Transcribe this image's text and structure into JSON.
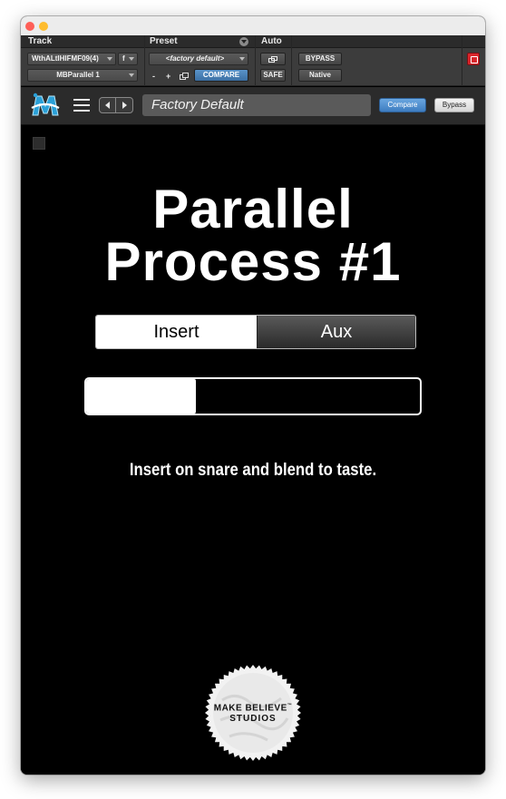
{
  "protools": {
    "headers": {
      "track": "Track",
      "preset": "Preset",
      "auto": "Auto"
    },
    "track_name": "WthALtIHIFMF09(4)",
    "track_letter": "f",
    "plugin_name": "MBParallel 1",
    "preset_value": "<factory default>",
    "minus": "-",
    "plus": "+",
    "compare": "COMPARE",
    "safe": "SAFE",
    "bypass": "BYPASS",
    "native": "Native"
  },
  "plugin_bar": {
    "preset_name": "Factory Default",
    "compare": "Compare",
    "bypass": "Bypass"
  },
  "main": {
    "title_line1": "Parallel",
    "title_line2": "Process #1",
    "mode_insert": "Insert",
    "mode_aux": "Aux",
    "selected_mode": "Insert",
    "blend_fraction": 0.33,
    "description": "Insert on snare and blend to taste."
  },
  "seal": {
    "line1": "MAKE BELIEVE",
    "tm": "™",
    "line2": "STUDIOS"
  },
  "colors": {
    "compare_blue": "#3d7cc0",
    "close_red": "#fe5f57",
    "minimize_yellow": "#febc2e",
    "logo_blue": "#2aa0d8"
  }
}
